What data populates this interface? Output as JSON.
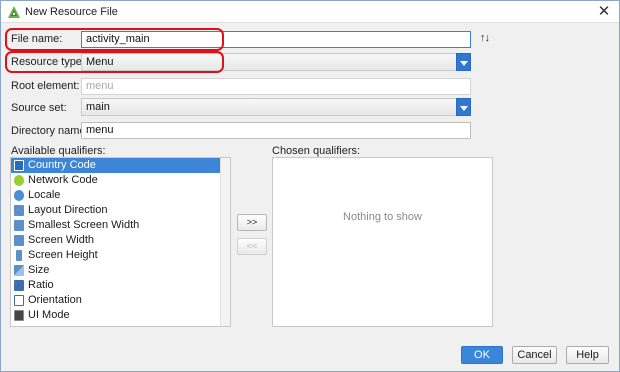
{
  "window": {
    "title": "New Resource File",
    "close_glyph": "✕"
  },
  "form": {
    "file_name": {
      "label": "File name:",
      "value": "activity_main"
    },
    "sort_glyph": "↑↓",
    "resource_type": {
      "label": "Resource type:",
      "value": "Menu"
    },
    "root_element": {
      "label": "Root element:",
      "value": "menu"
    },
    "source_set": {
      "label": "Source set:",
      "value": "main"
    },
    "directory_name": {
      "label": "Directory name:",
      "value": "menu"
    }
  },
  "qualifiers": {
    "available_label": "Available qualifiers:",
    "chosen_label": "Chosen qualifiers:",
    "empty_text": "Nothing to show",
    "add_label": ">>",
    "remove_label": "<<",
    "items": [
      {
        "label": "Country Code",
        "icon": "country-code-icon",
        "selected": true
      },
      {
        "label": "Network Code",
        "icon": "network-code-icon"
      },
      {
        "label": "Locale",
        "icon": "locale-icon"
      },
      {
        "label": "Layout Direction",
        "icon": "layout-direction-icon"
      },
      {
        "label": "Smallest Screen Width",
        "icon": "smallest-screen-width-icon"
      },
      {
        "label": "Screen Width",
        "icon": "screen-width-icon"
      },
      {
        "label": "Screen Height",
        "icon": "screen-height-icon"
      },
      {
        "label": "Size",
        "icon": "size-icon"
      },
      {
        "label": "Ratio",
        "icon": "ratio-icon"
      },
      {
        "label": "Orientation",
        "icon": "orientation-icon"
      },
      {
        "label": "UI Mode",
        "icon": "ui-mode-icon"
      }
    ]
  },
  "buttons": {
    "ok": "OK",
    "cancel": "Cancel",
    "help": "Help"
  },
  "colors": {
    "accent": "#3a86d8",
    "highlight": "#e0101a",
    "selection": "#3d85d6"
  }
}
